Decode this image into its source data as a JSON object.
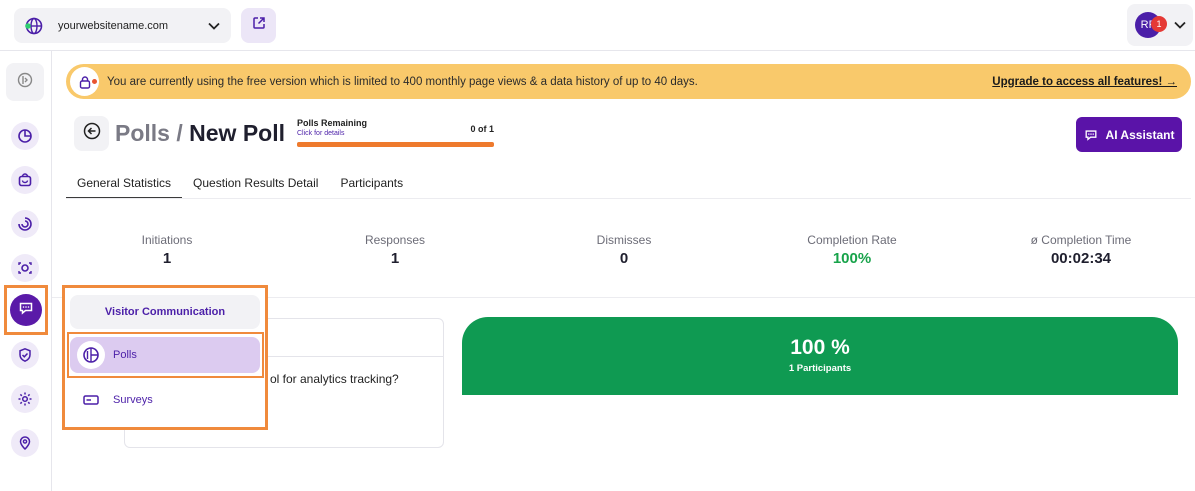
{
  "topbar": {
    "site_name": "yourwebsitename.com",
    "user_initials": "RF",
    "notification_count": "1"
  },
  "banner": {
    "text": "You are currently using the free version which is limited to 400 monthly page views & a data history of up to 40 days.",
    "upgrade_link": "Upgrade to access all features! →"
  },
  "header": {
    "breadcrumb_parent": "Polls",
    "separator": " / ",
    "title": "New Poll",
    "remaining_label": "Polls Remaining",
    "remaining_link": "Click for details",
    "remaining_count": "0 of 1",
    "remaining_fill_fraction": 1,
    "ai_button": "AI Assistant"
  },
  "tabs": [
    {
      "label": "General Statistics",
      "active": true
    },
    {
      "label": "Question Results Detail",
      "active": false
    },
    {
      "label": "Participants",
      "active": false
    }
  ],
  "stats": [
    {
      "label": "Initiations",
      "value": "1"
    },
    {
      "label": "Responses",
      "value": "1"
    },
    {
      "label": "Dismisses",
      "value": "0"
    },
    {
      "label": "Completion Rate",
      "value": "100%"
    },
    {
      "label": "ø Completion Time",
      "value": "00:02:34"
    }
  ],
  "question": {
    "text": "ol for analytics tracking?"
  },
  "result": {
    "percent": "100 %",
    "participants": "1 Participants"
  },
  "popup": {
    "heading": "Visitor Communication",
    "items": [
      {
        "label": "Polls",
        "icon": "polls-icon",
        "selected": true
      },
      {
        "label": "Surveys",
        "icon": "surveys-icon",
        "selected": false
      }
    ]
  },
  "colors": {
    "accent": "#5a13a8",
    "banner": "#f9c96b",
    "success": "#0f9a52",
    "highlight": "#f08a3c",
    "progress": "#ee7a2d"
  },
  "sidebar_icons": [
    "collapse-icon",
    "dashboard-icon",
    "shopping-bag-icon",
    "funnel-icon",
    "eye-icon",
    "chat-icon",
    "shield-icon",
    "gear-icon",
    "location-icon"
  ]
}
